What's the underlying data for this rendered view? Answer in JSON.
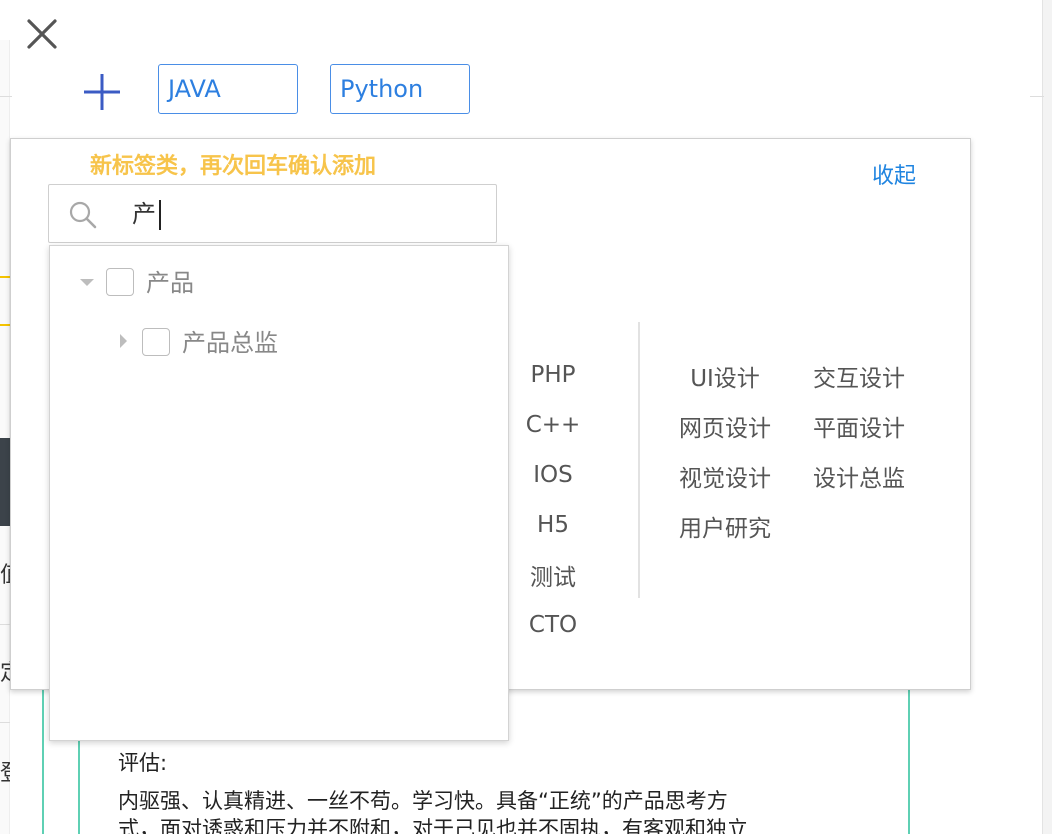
{
  "tags": {
    "add_icon": "plus-icon",
    "items": [
      "JAVA",
      "Python"
    ]
  },
  "panel": {
    "hint": "新标签类，再次回车确认添加",
    "collapse_label": "收起"
  },
  "search": {
    "value": "产",
    "icon": "search-icon"
  },
  "tree": {
    "parent": {
      "label": "产品",
      "expanded": true,
      "checked": false
    },
    "child": {
      "label": "产品总监",
      "checked": false
    }
  },
  "tech_column": [
    "PHP",
    "C++",
    "IOS",
    "H5",
    "测试",
    "CTO"
  ],
  "design_column_left": [
    "UI设计",
    "网页设计",
    "视觉设计",
    "用户研究"
  ],
  "design_column_right": [
    "交互设计",
    "平面设计",
    "设计总监"
  ],
  "evaluation": {
    "title": "评估:",
    "line1": "内驱强、认真精进、一丝不苟。学习快。具备“正统”的产品思考方",
    "line2": "式，面对诱惑和压力并不附和，对于己见也并不固执，有客观和独立"
  },
  "background": {
    "chars": [
      "值",
      "定",
      "登"
    ]
  },
  "colors": {
    "accent_blue": "#2d7fe0",
    "hint_yellow": "#f7c44b",
    "link_blue": "#1f84e0",
    "teal_border": "#5fd0b4"
  }
}
